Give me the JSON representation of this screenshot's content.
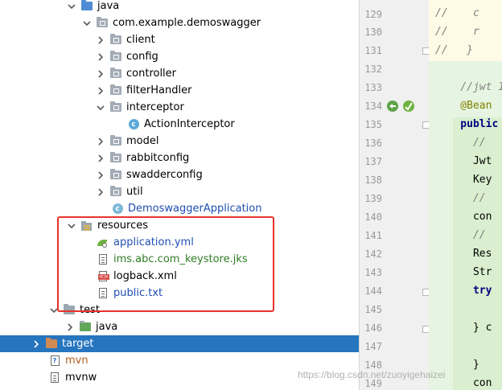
{
  "tree": {
    "rows": [
      {
        "label": "java",
        "icon": "folder-blue",
        "chevron": "down"
      },
      {
        "label": "com.example.demoswagger",
        "icon": "package-folder",
        "chevron": "down"
      },
      {
        "label": "client",
        "icon": "package-folder",
        "chevron": "right"
      },
      {
        "label": "config",
        "icon": "package-folder",
        "chevron": "right"
      },
      {
        "label": "controller",
        "icon": "package-folder",
        "chevron": "right"
      },
      {
        "label": "filterHandler",
        "icon": "package-folder",
        "chevron": "right"
      },
      {
        "label": "interceptor",
        "icon": "package-folder",
        "chevron": "down"
      },
      {
        "label": "ActionInterceptor",
        "icon": "class-c",
        "chevron": ""
      },
      {
        "label": "model",
        "icon": "package-folder",
        "chevron": "right"
      },
      {
        "label": "rabbitconfig",
        "icon": "package-folder",
        "chevron": "right"
      },
      {
        "label": "swadderconfig",
        "icon": "package-folder",
        "chevron": "right"
      },
      {
        "label": "util",
        "icon": "package-folder",
        "chevron": "right"
      },
      {
        "label": "DemoswaggerApplication",
        "icon": "class-c",
        "chevron": ""
      },
      {
        "label": "resources",
        "icon": "resources-folder",
        "chevron": "down"
      },
      {
        "label": "application.yml",
        "icon": "yml-leaf",
        "chevron": ""
      },
      {
        "label": "ims.abc.com_keystore.jks",
        "icon": "doc",
        "chevron": ""
      },
      {
        "label": "logback.xml",
        "icon": "xml",
        "chevron": ""
      },
      {
        "label": "public.txt",
        "icon": "doc",
        "chevron": ""
      },
      {
        "label": "test",
        "icon": "folder-plain",
        "chevron": "down"
      },
      {
        "label": "java",
        "icon": "folder-green",
        "chevron": "right"
      },
      {
        "label": "target",
        "icon": "folder-target",
        "chevron": "right",
        "selected": true
      },
      {
        "label": "mvn",
        "icon": "question-doc",
        "chevron": ""
      },
      {
        "label": "mvnw",
        "icon": "doc",
        "chevron": ""
      }
    ]
  },
  "editor": {
    "line_numbers": [
      "129",
      "130",
      "131",
      "132",
      "133",
      "134",
      "135",
      "136",
      "137",
      "138",
      "139",
      "140",
      "141",
      "142",
      "143",
      "144",
      "145",
      "146",
      "147",
      "148",
      "149"
    ],
    "lines": [
      "//    c",
      "//    r",
      "//   }",
      "",
      "    //jwt 1",
      "    @Bean",
      "    public",
      "      //",
      "      Jwt",
      "      Key",
      "      //",
      "      con",
      "      //",
      "      Res",
      "      Str",
      "      try",
      "",
      "      } c",
      "",
      "      }",
      "      con"
    ]
  },
  "watermark": "https://blog.csdn.net/zuoyigehaizei"
}
